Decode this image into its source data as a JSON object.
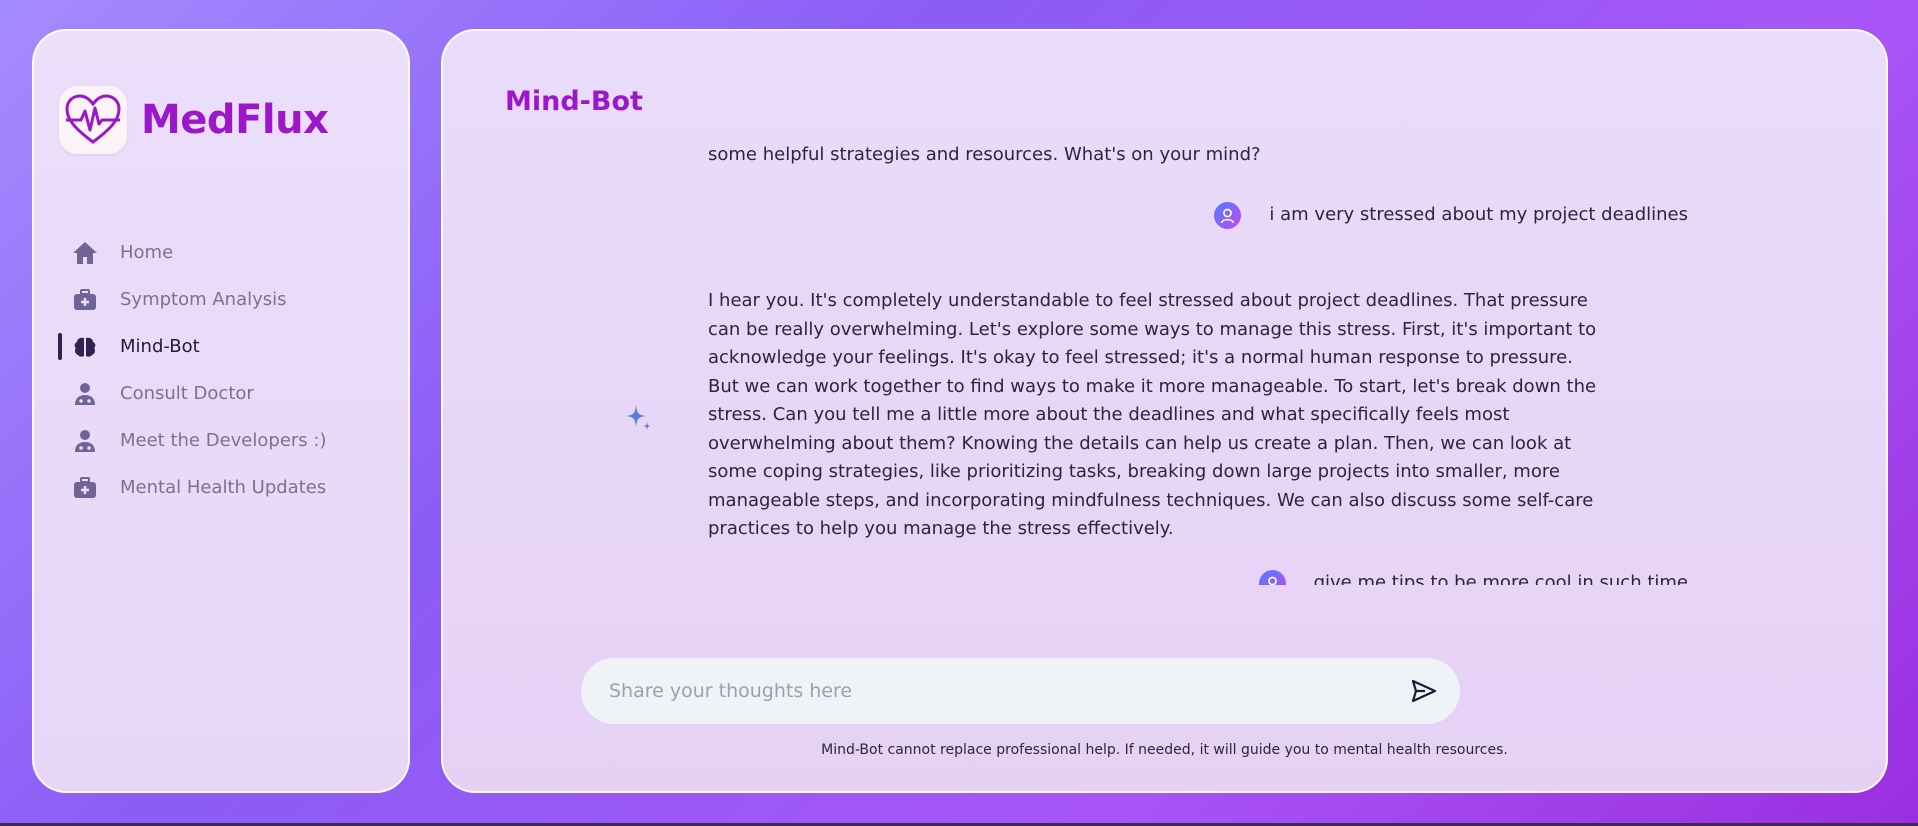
{
  "brand": {
    "name": "MedFlux",
    "logo_icon": "heart-pulse-icon"
  },
  "sidebar": {
    "items": [
      {
        "label": "Home",
        "icon": "home-icon",
        "active": false
      },
      {
        "label": "Symptom Analysis",
        "icon": "medical-kit-icon",
        "active": false
      },
      {
        "label": "Mind-Bot",
        "icon": "brain-icon",
        "active": true
      },
      {
        "label": "Consult Doctor",
        "icon": "doctor-icon",
        "active": false
      },
      {
        "label": "Meet the Developers :)",
        "icon": "developer-icon",
        "active": false
      },
      {
        "label": "Mental Health Updates",
        "icon": "medical-kit-icon",
        "active": false
      }
    ]
  },
  "main": {
    "title": "Mind-Bot",
    "messages": [
      {
        "role": "bot",
        "text": "some helpful strategies and resources. What's on your mind?"
      },
      {
        "role": "user",
        "text": "i am very stressed about my project deadlines"
      },
      {
        "role": "bot",
        "text": "I hear you. It's completely understandable to feel stressed about project deadlines. That pressure can be really overwhelming. Let's explore some ways to manage this stress. First, it's important to acknowledge your feelings. It's okay to feel stressed; it's a normal human response to pressure. But we can work together to find ways to make it more manageable. To start, let's break down the stress. Can you tell me a little more about the deadlines and what specifically feels most overwhelming about them? Knowing the details can help us create a plan. Then, we can look at some coping strategies, like prioritizing tasks, breaking down large projects into smaller, more manageable steps, and incorporating mindfulness techniques. We can also discuss some self-care practices to help you manage the stress effectively."
      },
      {
        "role": "user",
        "text": "give me tips to be more cool in such time"
      }
    ]
  },
  "input": {
    "placeholder": "Share your thoughts here",
    "value": ""
  },
  "disclaimer": "Mind-Bot cannot replace professional help. If needed, it will guide you to mental health resources.",
  "colors": {
    "accent": "#9b17c9",
    "nav_text": "#7a7196",
    "nav_icon": "#6e6596",
    "active_text": "#1e1b3a"
  }
}
